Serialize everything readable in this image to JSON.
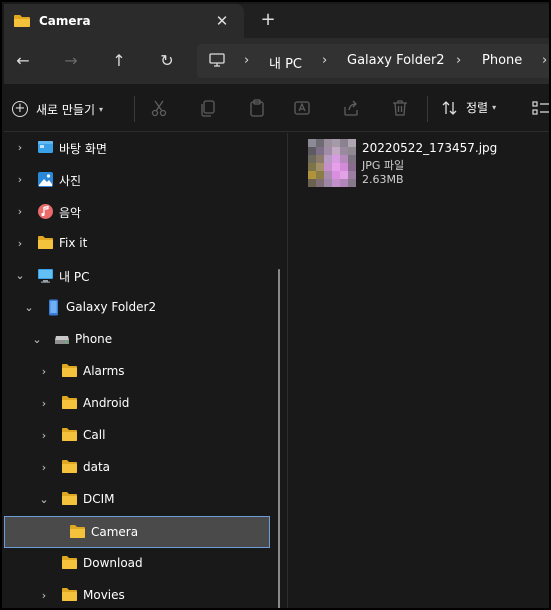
{
  "tab": {
    "title": "Camera",
    "close_glyph": "✕",
    "new_glyph": "+"
  },
  "nav": {
    "back_glyph": "←",
    "forward_glyph": "→",
    "up_glyph": "↑",
    "refresh_glyph": "↻",
    "breadcrumb_sep": "›",
    "breadcrumbs": [
      "내 PC",
      "Galaxy Folder2",
      "Phone"
    ]
  },
  "toolbar": {
    "new_label": "새로 만들기",
    "sort_label": "정렬",
    "icons": [
      "cut-icon",
      "copy-icon",
      "paste-icon",
      "rename-icon",
      "share-icon",
      "delete-icon",
      "view-icon"
    ]
  },
  "sidebar": {
    "items": [
      {
        "label": "바탕 화면",
        "icon": "desktop-icon",
        "chevron": "›"
      },
      {
        "label": "사진",
        "icon": "pictures-icon",
        "chevron": "›"
      },
      {
        "label": "음악",
        "icon": "music-icon",
        "chevron": "›"
      },
      {
        "label": "Fix it",
        "icon": "folder-icon",
        "chevron": "›"
      },
      {
        "label": "내 PC",
        "icon": "pc-icon",
        "chevron": "⌄"
      },
      {
        "label": "Galaxy Folder2",
        "icon": "phone-device-icon",
        "chevron": "⌄"
      },
      {
        "label": "Phone",
        "icon": "drive-icon",
        "chevron": "⌄"
      },
      {
        "label": "Alarms",
        "icon": "folder-icon",
        "chevron": "›"
      },
      {
        "label": "Android",
        "icon": "folder-icon",
        "chevron": "›"
      },
      {
        "label": "Call",
        "icon": "folder-icon",
        "chevron": "›"
      },
      {
        "label": "data",
        "icon": "folder-icon",
        "chevron": "›"
      },
      {
        "label": "DCIM",
        "icon": "folder-icon",
        "chevron": "⌄"
      },
      {
        "label": "Camera",
        "icon": "folder-icon",
        "chevron": ""
      },
      {
        "label": "Download",
        "icon": "folder-icon",
        "chevron": ""
      },
      {
        "label": "Movies",
        "icon": "folder-icon",
        "chevron": "›"
      }
    ]
  },
  "files": [
    {
      "name": "20220522_173457.jpg",
      "type": "JPG 파일",
      "size": "2.63MB"
    }
  ],
  "colors": {
    "folder": "#f5c33b",
    "folder_dark": "#e0a820",
    "selection_border": "#6b9ed6",
    "accent_blue": "#3aa0e8"
  }
}
